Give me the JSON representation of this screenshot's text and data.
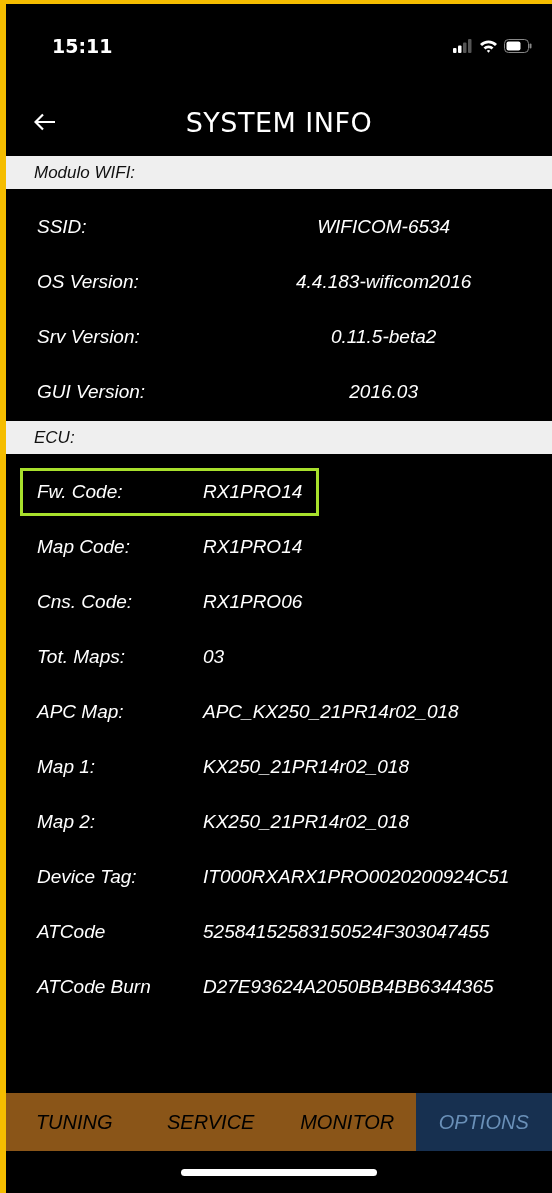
{
  "status_bar": {
    "time": "15:11"
  },
  "header": {
    "title": "SYSTEM INFO"
  },
  "sections": [
    {
      "title": "Modulo WIFI:",
      "kind": "centered",
      "rows": [
        {
          "label": "SSID:",
          "value": "WIFICOM-6534",
          "highlighted": false
        },
        {
          "label": "OS Version:",
          "value": "4.4.183-wificom2016",
          "highlighted": false
        },
        {
          "label": "Srv Version:",
          "value": "0.11.5-beta2",
          "highlighted": false
        },
        {
          "label": "GUI Version:",
          "value": "2016.03",
          "highlighted": false
        }
      ]
    },
    {
      "title": "ECU:",
      "kind": "left",
      "rows": [
        {
          "label": "Fw. Code:",
          "value": "RX1PRO14",
          "highlighted": true
        },
        {
          "label": "Map Code:",
          "value": "RX1PRO14",
          "highlighted": false
        },
        {
          "label": "Cns. Code:",
          "value": "RX1PRO06",
          "highlighted": false
        },
        {
          "label": "Tot. Maps:",
          "value": "03",
          "highlighted": false
        },
        {
          "label": "APC Map:",
          "value": "APC_KX250_21PR14r02_018",
          "highlighted": false
        },
        {
          "label": "Map 1:",
          "value": "KX250_21PR14r02_018",
          "highlighted": false
        },
        {
          "label": "Map 2:",
          "value": "KX250_21PR14r02_018",
          "highlighted": false
        },
        {
          "label": "Device Tag:",
          "value": "IT000RXARX1PRO0020200924C51",
          "highlighted": false
        },
        {
          "label": "ATCode",
          "value": "52584152583150524F303047455",
          "highlighted": false
        },
        {
          "label": "ATCode Burn",
          "value": "D27E93624A2050BB4BB6344365",
          "highlighted": false
        }
      ]
    }
  ],
  "tabs": [
    {
      "label": "TUNING",
      "selected": false
    },
    {
      "label": "SERVICE",
      "selected": false
    },
    {
      "label": "MONITOR",
      "selected": false
    },
    {
      "label": "OPTIONS",
      "selected": true
    }
  ]
}
